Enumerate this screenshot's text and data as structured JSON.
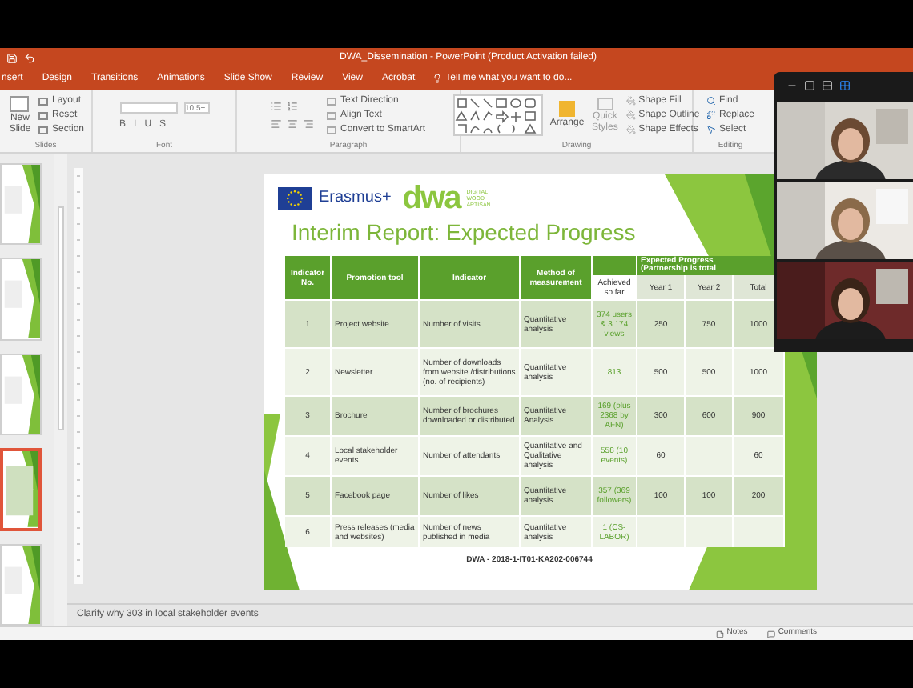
{
  "window": {
    "title": "DWA_Dissemination - PowerPoint (Product Activation failed)"
  },
  "tabs": [
    {
      "label": "nsert",
      "selected": false
    },
    {
      "label": "Design",
      "selected": false
    },
    {
      "label": "Transitions",
      "selected": false
    },
    {
      "label": "Animations",
      "selected": false
    },
    {
      "label": "Slide Show",
      "selected": false
    },
    {
      "label": "Review",
      "selected": false
    },
    {
      "label": "View",
      "selected": false
    },
    {
      "label": "Acrobat",
      "selected": false
    }
  ],
  "tell_me": {
    "placeholder": "Tell me what you want to do..."
  },
  "ribbon": {
    "slides": {
      "label": "Slides",
      "new_slide": "New Slide",
      "items": [
        "Layout",
        "Reset",
        "Section"
      ]
    },
    "font": {
      "label": "Font",
      "size": "10.5+",
      "buttons": [
        "B",
        "I",
        "U",
        "S"
      ]
    },
    "paragraph": {
      "label": "Paragraph",
      "items": [
        "Text Direction",
        "Align Text",
        "Convert to SmartArt"
      ]
    },
    "drawing": {
      "label": "Drawing",
      "arrange": "Arrange",
      "quick_styles": "Quick Styles",
      "items": [
        "Shape Fill",
        "Shape Outline",
        "Shape Effects"
      ]
    },
    "editing": {
      "label": "Editing",
      "items": [
        "Find",
        "Replace",
        "Select"
      ]
    }
  },
  "thumbnails": [
    {
      "selected": false
    },
    {
      "selected": false
    },
    {
      "selected": false
    },
    {
      "selected": true
    },
    {
      "selected": false
    }
  ],
  "slide": {
    "logo_text": "Erasmus+",
    "brand": "dwa",
    "brand_lines": [
      "DIGITAL",
      "WOOD",
      "ARTISAN"
    ],
    "title": "Interim Report: Expected Progress",
    "table": {
      "columns": [
        "Indicator No.",
        "Promotion tool",
        "Indicator",
        "Method of measurement"
      ],
      "group_header": "Expected Progress (Partnership is total",
      "sub_columns": [
        "Achieved so far",
        "Year 1",
        "Year 2",
        "Total"
      ],
      "rows": [
        [
          "1",
          "Project website",
          "Number of visits",
          "Quantitative analysis",
          "374 users & 3.174 views",
          "250",
          "750",
          "1000"
        ],
        [
          "2",
          "Newsletter",
          "Number of downloads from website /distributions (no. of recipients)",
          "Quantitative analysis",
          "813",
          "500",
          "500",
          "1000"
        ],
        [
          "3",
          "Brochure",
          "Number of brochures downloaded or distributed",
          "Quantitative Analysis",
          "169 (plus 2368 by AFN)",
          "300",
          "600",
          "900"
        ],
        [
          "4",
          "Local stakeholder events",
          "Number of attendants",
          "Quantitative and Qualitative analysis",
          "558 (10 events)",
          "60",
          "",
          "60"
        ],
        [
          "5",
          "Facebook page",
          "Number of likes",
          "Quantitative analysis",
          "357 (369 followers)",
          "100",
          "100",
          "200"
        ],
        [
          "6",
          "Press releases (media and websites)",
          "Number of news published in media",
          "Quantitative analysis",
          "1 (CS-LABOR)",
          "",
          "",
          ""
        ]
      ]
    },
    "footer": "DWA - 2018-1-IT01-KA202-006744"
  },
  "notes": "Clarify why 303 in local stakeholder events",
  "status_bar": {
    "items": [
      "Notes",
      "Comments"
    ]
  },
  "video_panel": {
    "layouts": [
      {
        "selected": false
      },
      {
        "selected": false
      },
      {
        "selected": false
      },
      {
        "selected": true
      }
    ]
  }
}
